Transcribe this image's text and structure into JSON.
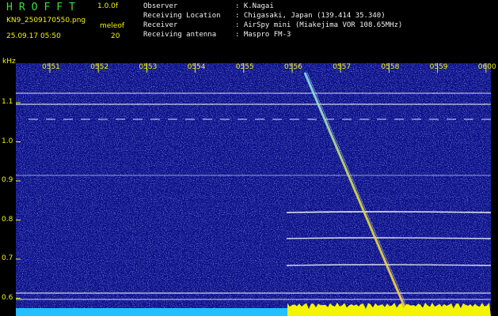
{
  "header": {
    "app_title": "HROFFT",
    "version": "1.0.0f",
    "filename": "KN9_2509170550.png",
    "mode": "meleof",
    "mode_value": "20",
    "datetime": "25.09.17 05:50",
    "info": [
      {
        "label": "Observer",
        "value": ": K.Nagai"
      },
      {
        "label": "Receiving Location",
        "value": ": Chigasaki, Japan (139.414 35.340)"
      },
      {
        "label": "Receiver",
        "value": ": AirSpy mini (Miakejima VOR 108.65MHz)"
      },
      {
        "label": "Receiving antenna",
        "value": ": Maspro FM-3"
      }
    ]
  },
  "plot": {
    "unit": "kHz",
    "time_ticks": [
      "0551",
      "0552",
      "0553",
      "0554",
      "0555",
      "0556",
      "0557",
      "0558",
      "0559",
      "0600"
    ],
    "freq_ticks": [
      "1.1",
      "1.0",
      "0.9",
      "0.8",
      "0.7",
      "0.6"
    ],
    "colors": {
      "background": "#0a0f8a",
      "carrier": "#ffffff",
      "meteor": "#c8c84a",
      "level": "#f4f400",
      "level_low": "#22c0ff"
    }
  }
}
